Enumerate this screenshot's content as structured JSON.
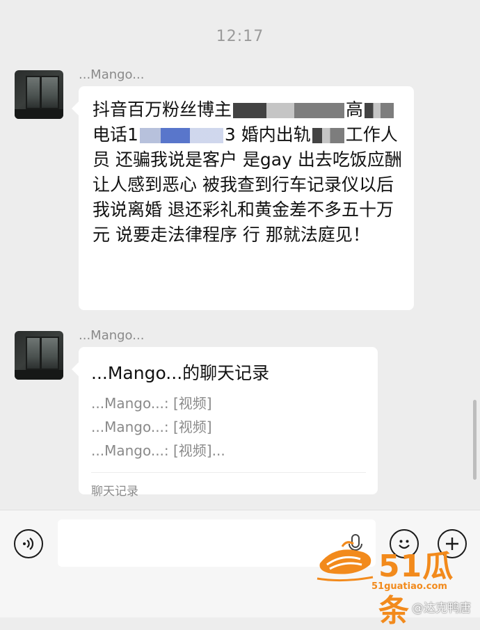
{
  "time": "12:17",
  "messages": [
    {
      "sender": "...Mango...",
      "text_parts": [
        "抖音百万粉丝博主",
        "高",
        "电话1",
        "3 婚内出轨",
        "工作人员 还骗我说是客户 是gay 出去吃饭应酬 让人感到恶心 被我查到行车记录仪以后 我说离婚 退还彩礼和黄金差不多五十万元 说要走法律程序 行 那就法庭见！"
      ]
    },
    {
      "sender": "...Mango...",
      "record": {
        "title": "...Mango...的聊天记录",
        "lines": [
          "...Mango...: [视频]",
          "...Mango...: [视频]",
          "...Mango...: [视频]..."
        ],
        "footer": "聊天记录"
      }
    }
  ],
  "input_bar": {
    "voice_icon": "voice-icon",
    "mic_icon": "microphone-icon",
    "emoji_icon": "emoji-icon",
    "plus_icon": "plus-icon"
  },
  "watermark": {
    "brand": "51瓜条",
    "url": "51guatiao.com",
    "weibo": "@达克鸭唐"
  },
  "colors": {
    "background": "#ededed",
    "bubble": "#ffffff",
    "watermark": "#f28a1c"
  }
}
